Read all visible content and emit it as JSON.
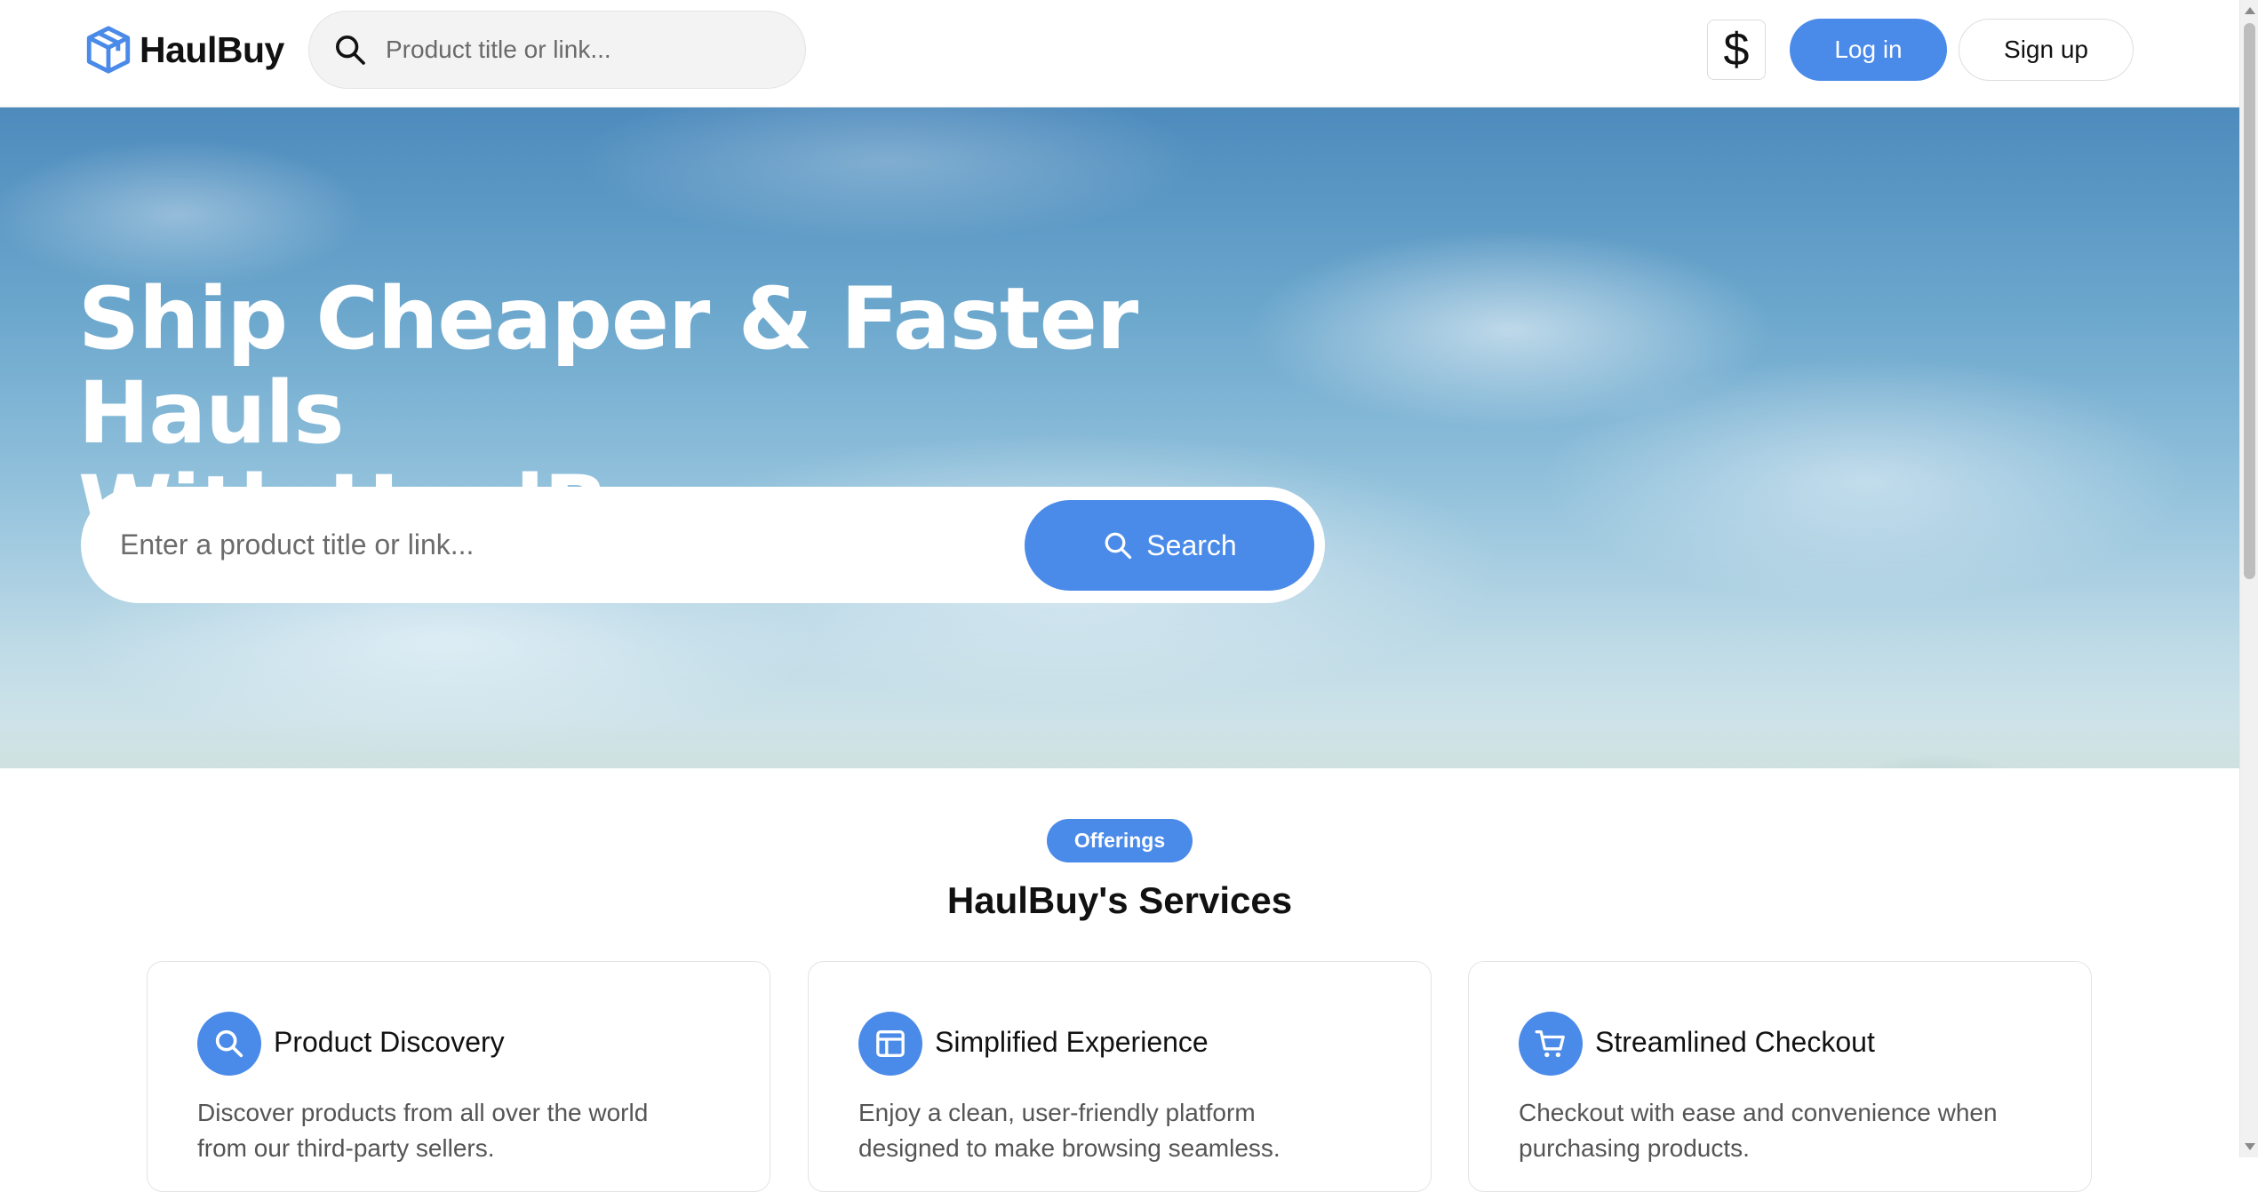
{
  "header": {
    "logo_text": "HaulBuy",
    "search_placeholder": "Product title or link...",
    "currency_symbol": "$",
    "login_label": "Log in",
    "signup_label": "Sign up"
  },
  "hero": {
    "title_line1": "Ship Cheaper & Faster Hauls",
    "title_line2": "With HaulBuy",
    "search_placeholder": "Enter a product title or link...",
    "search_button_label": "Search"
  },
  "offerings": {
    "badge": "Offerings",
    "title": "HaulBuy's Services",
    "cards": [
      {
        "icon": "search-icon",
        "title": "Product Discovery",
        "description": "Discover products from all over the world from our third-party sellers."
      },
      {
        "icon": "layout-icon",
        "title": "Simplified Experience",
        "description": "Enjoy a clean, user-friendly platform designed to make browsing seamless."
      },
      {
        "icon": "cart-icon",
        "title": "Streamlined Checkout",
        "description": "Checkout with ease and convenience when purchasing products."
      }
    ]
  },
  "colors": {
    "accent": "#4a8ae8",
    "text": "#111111",
    "muted_text": "#555555"
  }
}
